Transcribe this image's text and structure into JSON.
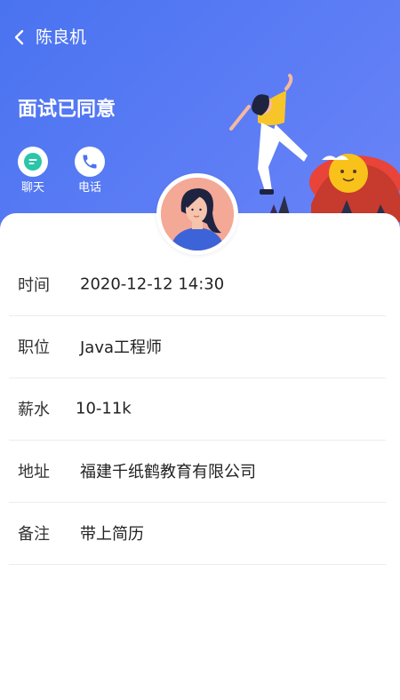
{
  "header": {
    "title": "陈良机",
    "status": "面试已同意",
    "gradient_start": "#4a73f0",
    "gradient_end": "#6b84f7",
    "actions": [
      {
        "label": "聊天",
        "icon": "chat-bubble-icon",
        "color": "#29c6a8"
      },
      {
        "label": "电话",
        "icon": "phone-icon",
        "color": "#4a73f0"
      }
    ]
  },
  "details": [
    {
      "key": "时间",
      "value": "2020-12-12 14:30"
    },
    {
      "key": "职位",
      "value": "Java工程师"
    },
    {
      "key": "薪水",
      "value": "10-11k"
    },
    {
      "key": "地址",
      "value": "福建千纸鹤教育有限公司"
    },
    {
      "key": "备注",
      "value": "带上简历"
    }
  ]
}
